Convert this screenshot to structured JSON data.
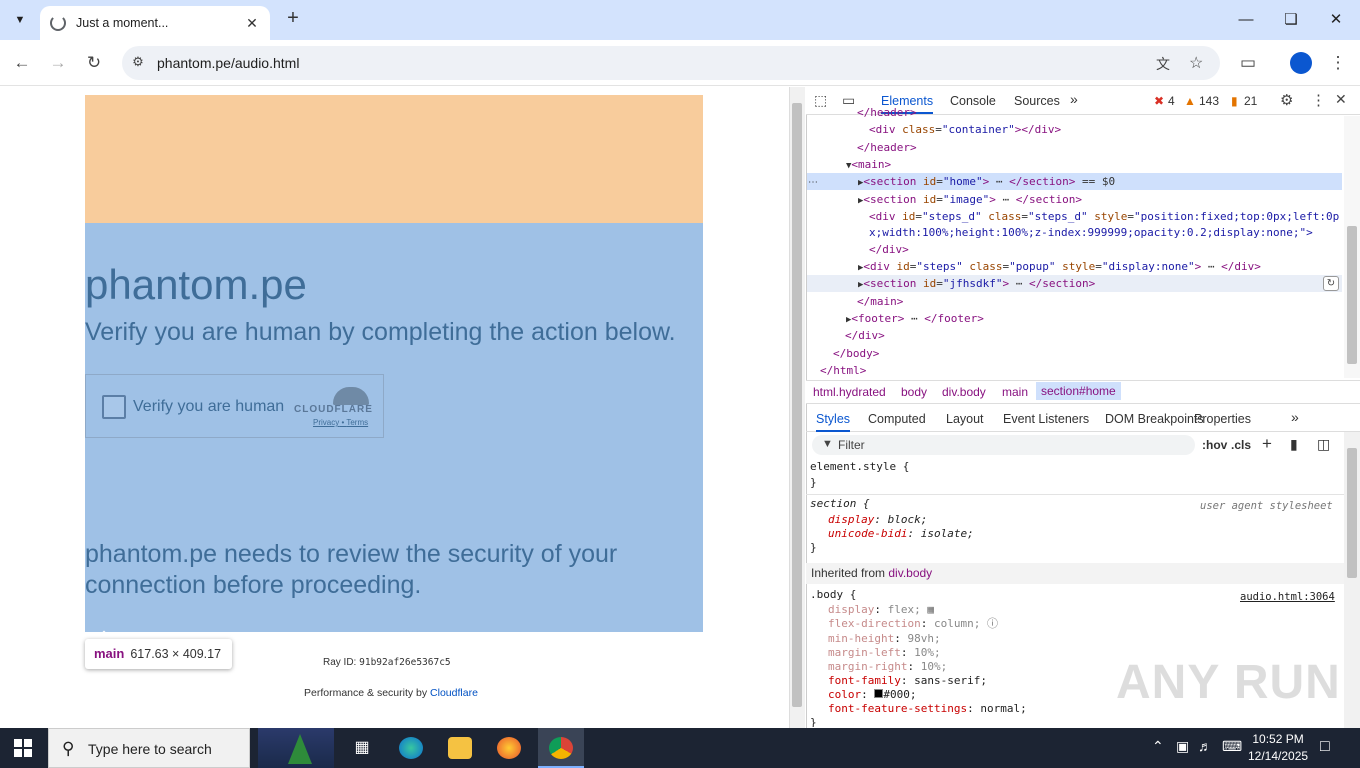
{
  "browser": {
    "tab_title": "Just a moment...",
    "url": "phantom.pe/audio.html"
  },
  "page": {
    "site_title": "phantom.pe",
    "verify_heading": "Verify you are human by completing the action below.",
    "checkbox_label": "Verify you are human",
    "cloudflare_logo": "CLOUDFLARE",
    "privacy_link": "Privacy",
    "terms_sep": " • ",
    "terms_link": "Terms",
    "review_text": "phantom.pe needs to review the security of your connection before proceeding.",
    "ray_id_label": "Ray ID: ",
    "ray_id": "91b92af26e5367c5",
    "perf_text": "Performance & security by ",
    "perf_link": "Cloudflare",
    "tooltip_tag": "main",
    "tooltip_dims": "617.63 × 409.17",
    "colors": {
      "banner": "#f8cc9c",
      "highlight": "#9fc1e6",
      "text": "#3f6d98"
    }
  },
  "devtools": {
    "tabs": [
      "Elements",
      "Console",
      "Sources"
    ],
    "errors": "4",
    "warnings": "143",
    "issues": "21",
    "dom": {
      "l0": "</header>",
      "l1_open": "<div ",
      "l1_attr": "class",
      "l1_val": "\"container\"",
      "l1_close": "></div>",
      "l2": "</header>",
      "l3": "<main>",
      "l4_open": "<section ",
      "l4_attr": "id",
      "l4_val": "\"home\"",
      "l4_close": ">",
      "l4_end": "</section>",
      "l4_eq": " == $0",
      "l5_open": "<section ",
      "l5_attr": "id",
      "l5_val": "\"image\"",
      "l5_close": ">",
      "l5_end": "</section>",
      "l6_open": "<div ",
      "l6_a1": "id",
      "l6_v1": "\"steps_d\"",
      "l6_a2": "class",
      "l6_v2": "\"steps_d\"",
      "l6_a3": "style",
      "l6_v3a": "\"position:fixed;top:0px;left:0p",
      "l6b": "x;width:100%;height:100%;z-index:999999;opacity:0.2;display:none;\">",
      "l7": "</div>",
      "l8_open": "<div ",
      "l8_a1": "id",
      "l8_v1": "\"steps\"",
      "l8_a2": "class",
      "l8_v2": "\"popup\"",
      "l8_a3": "style",
      "l8_v3": "\"display:none\"",
      "l8_close": ">",
      "l8_end": "</div>",
      "l9_open": "<section ",
      "l9_attr": "id",
      "l9_val": "\"jfhsdkf\"",
      "l9_close": ">",
      "l9_end": "</section>",
      "l10": "</main>",
      "l11_open": "<footer>",
      "l11_end": "</footer>",
      "l12": "</div>",
      "l13": "</body>",
      "l14": "</html>"
    },
    "breadcrumbs": [
      "html.hydrated",
      "body",
      "div.body",
      "main",
      "section#home"
    ],
    "subtabs": [
      "Styles",
      "Computed",
      "Layout",
      "Event Listeners",
      "DOM Breakpoints",
      "Properties"
    ],
    "filter_placeholder": "Filter",
    "hov": ":hov",
    "cls": ".cls",
    "styles": {
      "element_style": "element.style {",
      "close": "}",
      "section_sel": "section {",
      "ua": "user agent stylesheet",
      "display_p": "display",
      "display_v": "block;",
      "ub_p": "unicode-bidi",
      "ub_v": "isolate;",
      "inherited": "Inherited from ",
      "inherited_from": "div.body",
      "body_sel": ".body {",
      "source": "audio.html:3064",
      "p1": "display",
      "v1": "flex;",
      "p2": "flex-direction",
      "v2": "column;",
      "p3": "min-height",
      "v3": "98vh;",
      "p4": "margin-left",
      "v4": "10%;",
      "p5": "margin-right",
      "v5": "10%;",
      "p6": "font-family",
      "v6": "sans-serif;",
      "p7": "color",
      "v7": "#000;",
      "p8": "font-feature-settings",
      "v8": "normal;"
    }
  },
  "taskbar": {
    "search_placeholder": "Type here to search",
    "time": "10:52 PM",
    "date": "12/14/2025"
  },
  "watermark": "ANY RUN"
}
